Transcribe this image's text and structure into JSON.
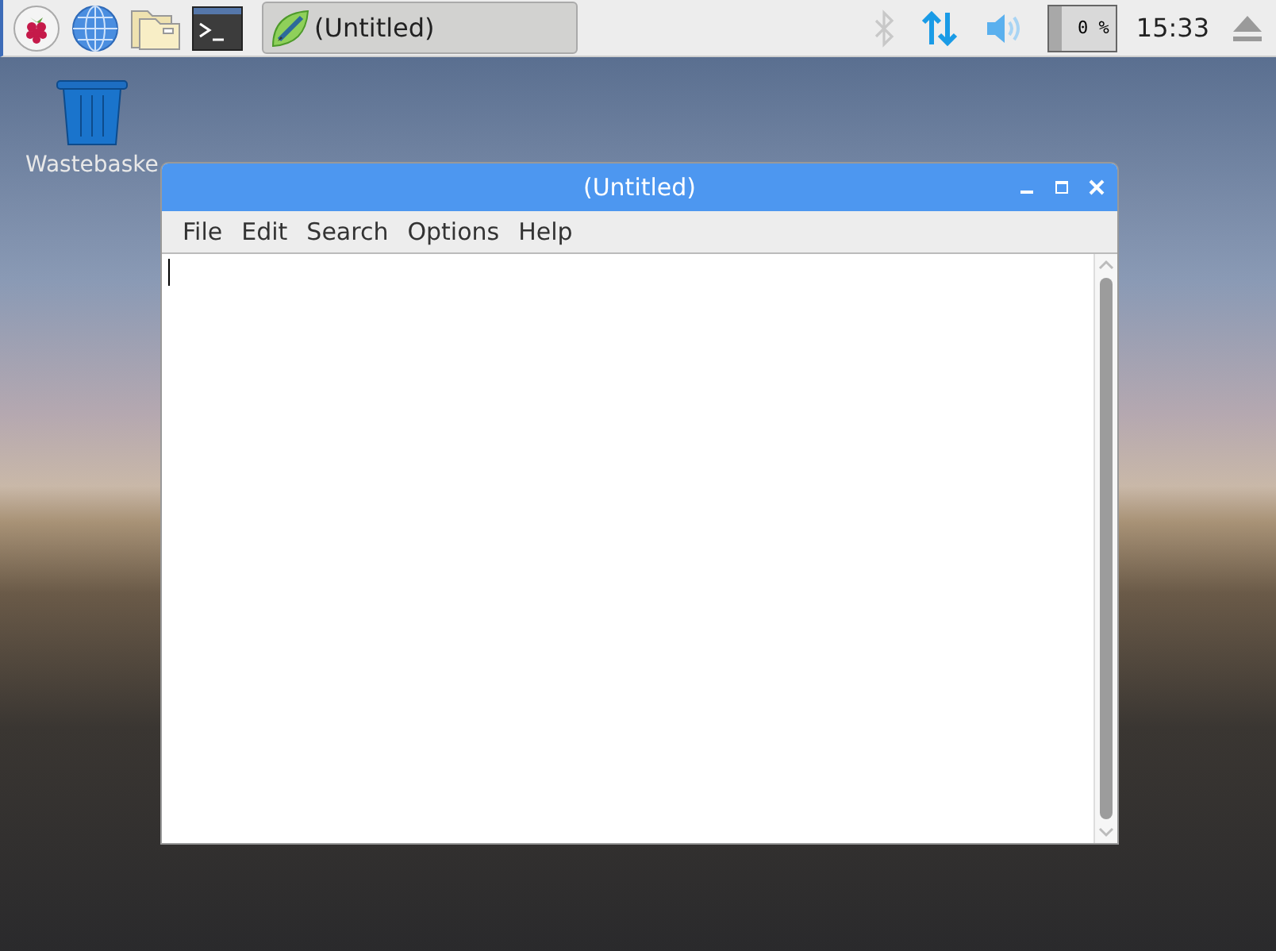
{
  "taskbar": {
    "launchers": [
      {
        "kind": "raspberry"
      },
      {
        "kind": "globe"
      },
      {
        "kind": "folder"
      },
      {
        "kind": "terminal"
      }
    ],
    "tasks": [
      {
        "label": "(Untitled)",
        "selected": true
      }
    ],
    "cpu_reading": "0 %",
    "clock": "15:33"
  },
  "desktop": {
    "icons": [
      {
        "label": "Wastebaske"
      }
    ]
  },
  "window": {
    "title": "(Untitled)",
    "menu": [
      "File",
      "Edit",
      "Search",
      "Options",
      "Help"
    ]
  }
}
